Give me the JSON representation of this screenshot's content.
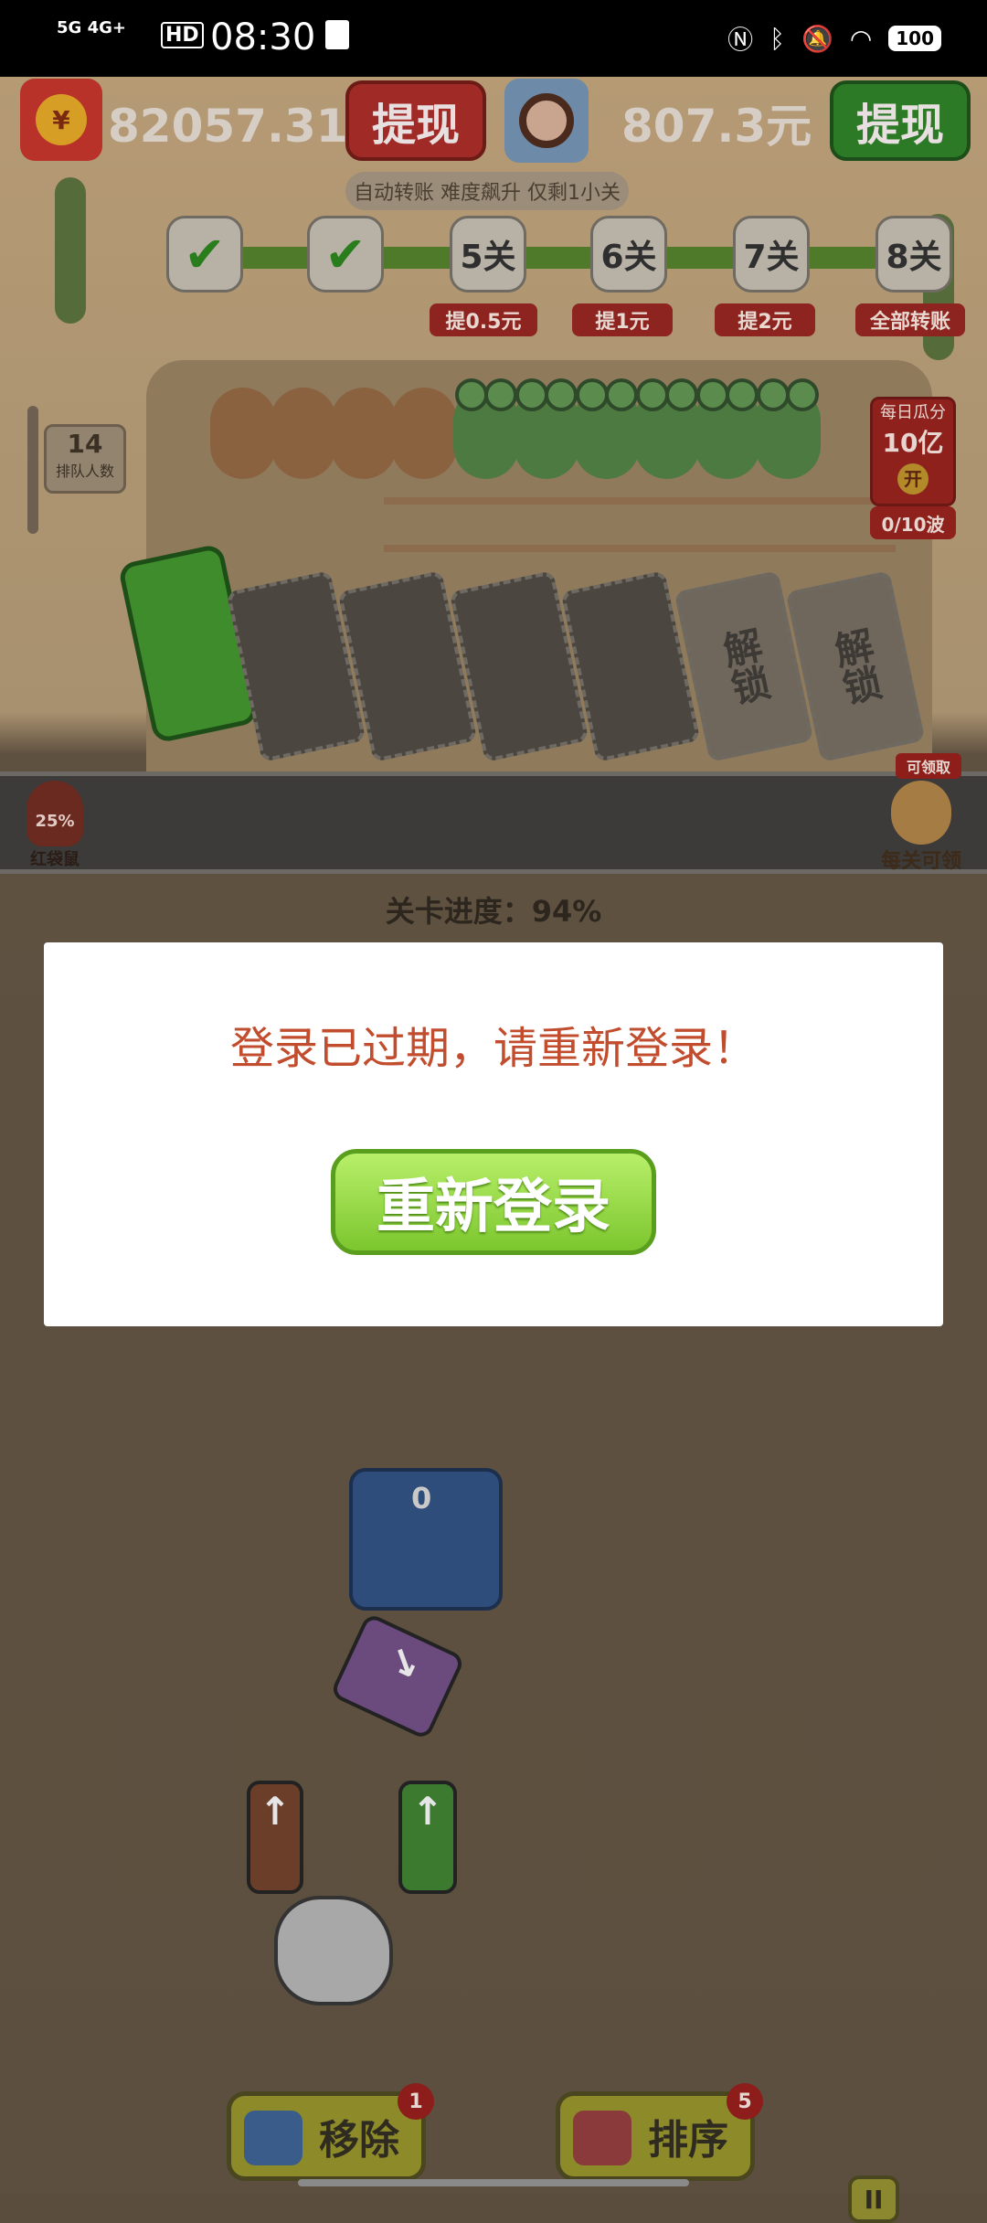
{
  "status_bar": {
    "network": "5G 4G+",
    "hd": "HD",
    "time": "08:30",
    "battery": "100"
  },
  "header": {
    "paw_symbol": "¥",
    "balance_left": "82057.31元",
    "withdraw_left": "提现",
    "balance_right": "807.3元",
    "withdraw_right": "提现"
  },
  "progress_track": {
    "subtitle": "自动转账 难度飙升 仅剩1小关",
    "nodes": [
      {
        "label": "✔",
        "done": true
      },
      {
        "label": "✔",
        "done": true
      },
      {
        "label": "5关",
        "reward": "提0.5元"
      },
      {
        "label": "6关",
        "reward": "提1元"
      },
      {
        "label": "7关",
        "reward": "提2元"
      },
      {
        "label": "8关",
        "reward": "全部转账"
      }
    ]
  },
  "queue": {
    "count": "14",
    "label": "排队人数"
  },
  "daily_pack": {
    "label": "每日瓜分",
    "amount": "10亿",
    "open": "开",
    "waves": "0/10波"
  },
  "slots": {
    "unlock_label": "解锁"
  },
  "hud": {
    "roo_percent": "25%",
    "roo_label": "红袋鼠",
    "free_tag": "可领取",
    "shiba_label": "每关可领",
    "level_progress": "关卡进度：94%"
  },
  "modal": {
    "message": "登录已过期，请重新登录！",
    "button": "重新登录"
  },
  "play": {
    "tunnel_count": "0"
  },
  "tools": {
    "remove_label": "移除",
    "remove_badge": "1",
    "sort_label": "排序",
    "sort_badge": "5",
    "pause_symbol": "II"
  }
}
